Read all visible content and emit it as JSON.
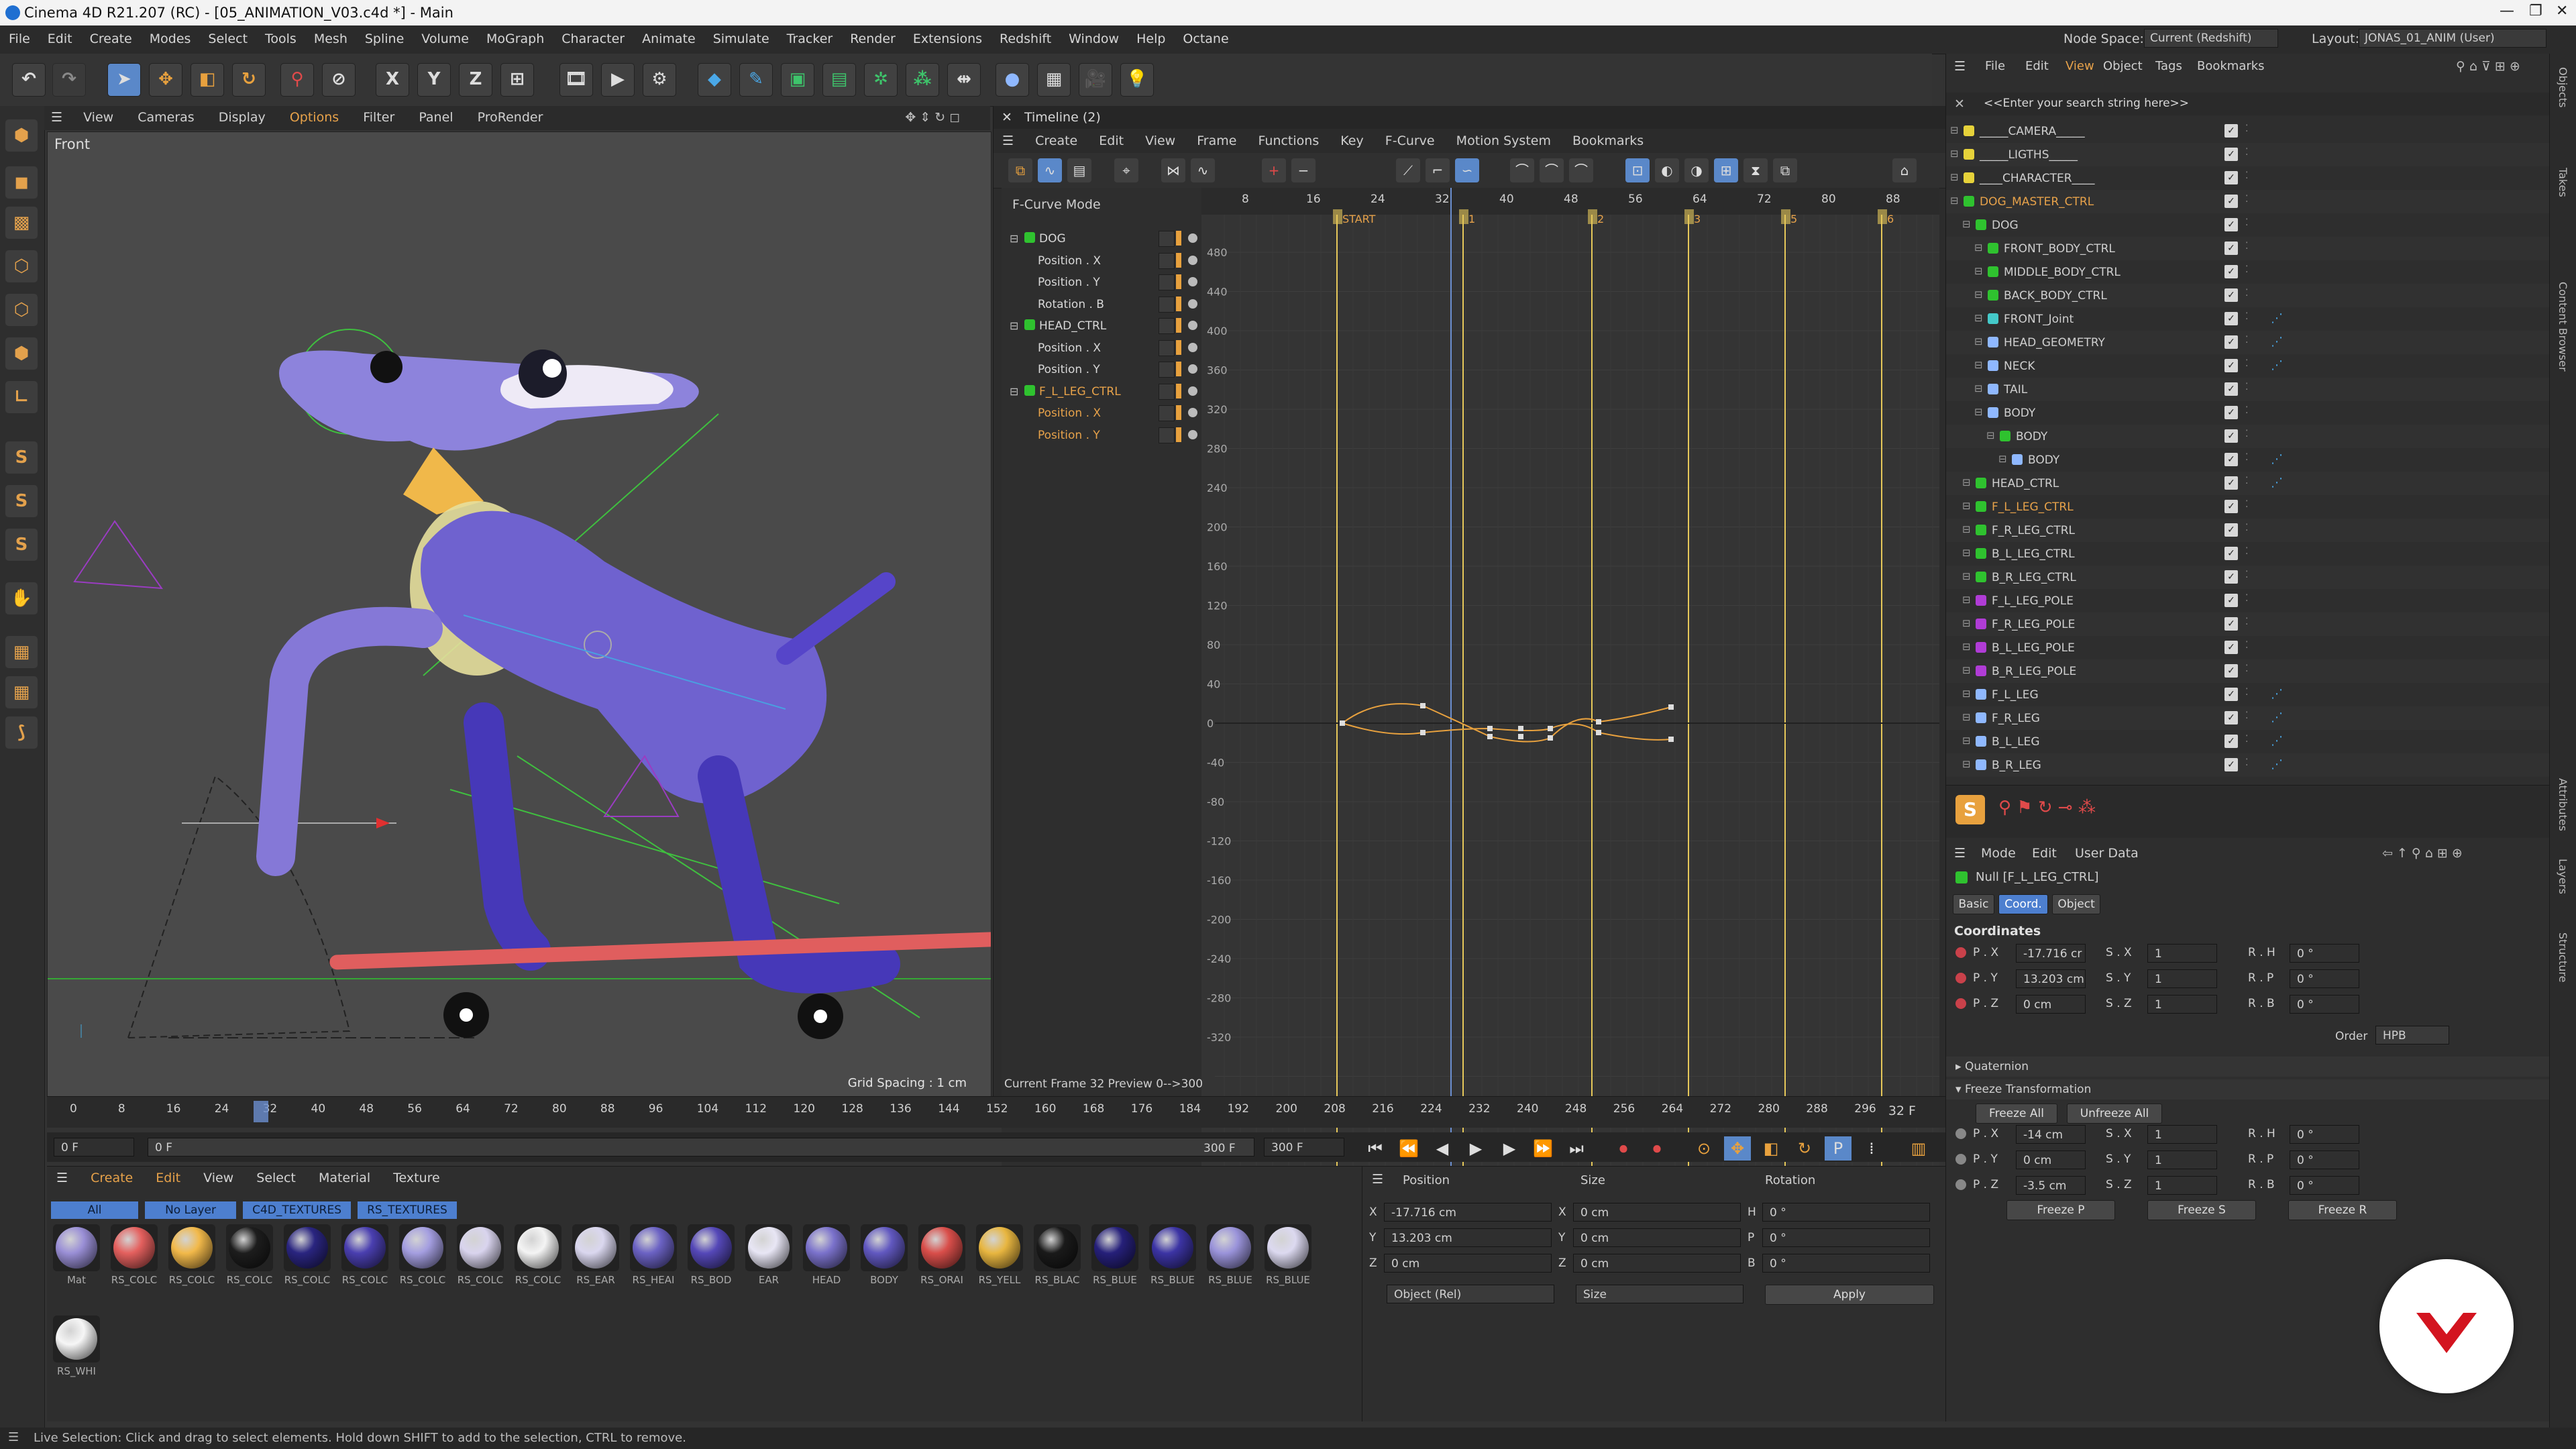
{
  "window": {
    "title": "Cinema 4D R21.207 (RC) - [05_ANIMATION_V03.c4d *] - Main",
    "node_space_label": "Node Space:",
    "node_space_value": "Current (Redshift)",
    "layout_label": "Layout:",
    "layout_value": "JONAS_01_ANIM (User)"
  },
  "menu": [
    "File",
    "Edit",
    "Create",
    "Modes",
    "Select",
    "Tools",
    "Mesh",
    "Spline",
    "Volume",
    "MoGraph",
    "Character",
    "Animate",
    "Simulate",
    "Tracker",
    "Render",
    "Extensions",
    "Redshift",
    "Window",
    "Help",
    "Octane"
  ],
  "viewport": {
    "menu": [
      "View",
      "Cameras",
      "Display",
      "Options",
      "Filter",
      "Panel",
      "ProRender"
    ],
    "name": "Front",
    "grid_spacing": "Grid Spacing : 1 cm"
  },
  "timeline": {
    "title": "Timeline (2)",
    "menu": [
      "Create",
      "Edit",
      "View",
      "Frame",
      "Functions",
      "Key",
      "F-Curve",
      "Motion System",
      "Bookmarks"
    ],
    "mode": "F-Curve Mode",
    "tracks": [
      {
        "name": "DOG",
        "type": "object"
      },
      {
        "name": "Position . X",
        "type": "param"
      },
      {
        "name": "Position . Y",
        "type": "param"
      },
      {
        "name": "Rotation . B",
        "type": "param"
      },
      {
        "name": "HEAD_CTRL",
        "type": "object"
      },
      {
        "name": "Position . X",
        "type": "param"
      },
      {
        "name": "Position . Y",
        "type": "param"
      },
      {
        "name": "F_L_LEG_CTRL",
        "type": "object-sel"
      },
      {
        "name": "Position . X",
        "type": "param-sel"
      },
      {
        "name": "Position . Y",
        "type": "param-sel"
      }
    ],
    "frame_ticks": [
      "8",
      "16",
      "24",
      "32",
      "40",
      "48",
      "56",
      "64",
      "72",
      "80",
      "88"
    ],
    "markers": [
      "START",
      "1",
      "2",
      "3",
      "5",
      "6"
    ],
    "value_ticks": [
      "480",
      "440",
      "400",
      "360",
      "320",
      "280",
      "240",
      "200",
      "160",
      "120",
      "80",
      "40",
      "0",
      "-40",
      "-80",
      "-120",
      "-160",
      "-200",
      "-240",
      "-280",
      "-320"
    ],
    "footer": "Current Frame  32  Preview  0-->300"
  },
  "ruler": {
    "ticks": [
      "0",
      "8",
      "16",
      "24",
      "32",
      "40",
      "48",
      "56",
      "64",
      "72",
      "80",
      "88",
      "96",
      "104",
      "112",
      "120",
      "128",
      "136",
      "144",
      "152",
      "160",
      "168",
      "176",
      "184",
      "192",
      "200",
      "208",
      "216",
      "224",
      "232",
      "240",
      "248",
      "256",
      "264",
      "272",
      "280",
      "288",
      "296"
    ],
    "current": "32 F"
  },
  "range": {
    "start": "0 F",
    "min": "0 F",
    "max": "300 F",
    "end": "300 F"
  },
  "materials": {
    "menu": [
      "Create",
      "Edit",
      "View",
      "Select",
      "Material",
      "Texture"
    ],
    "tabs": [
      "All",
      "No Layer",
      "C4D_TEXTURES",
      "RS_TEXTURES"
    ],
    "items": [
      {
        "name": "Mat",
        "color": "#9a8fd6"
      },
      {
        "name": "RS_COLC",
        "color": "#e4605e"
      },
      {
        "name": "RS_COLC",
        "color": "#f2b94a"
      },
      {
        "name": "RS_COLC",
        "color": "#1d1d1d"
      },
      {
        "name": "RS_COLC",
        "color": "#2a2580"
      },
      {
        "name": "RS_COLC",
        "color": "#4a3fb0"
      },
      {
        "name": "RS_COLC",
        "color": "#a49ee0"
      },
      {
        "name": "RS_COLC",
        "color": "#d9d4ee"
      },
      {
        "name": "RS_COLC",
        "color": "#f4f4f4"
      },
      {
        "name": "RS_EAR",
        "color": "#dad7ef"
      },
      {
        "name": "RS_HEAI",
        "color": "#6b62c4"
      },
      {
        "name": "RS_BOD",
        "color": "#5548b8"
      },
      {
        "name": "EAR",
        "color": "#e8e6f5"
      },
      {
        "name": "HEAD",
        "color": "#7b72cc"
      },
      {
        "name": "BODY",
        "color": "#6158c0"
      },
      {
        "name": "RS_ORAI",
        "color": "#d94e4a"
      },
      {
        "name": "RS_YELL",
        "color": "#e8b640"
      },
      {
        "name": "RS_BLAC",
        "color": "#1a1a1a"
      },
      {
        "name": "RS_BLUE",
        "color": "#26207a"
      },
      {
        "name": "RS_BLUE",
        "color": "#3c34a4"
      },
      {
        "name": "RS_BLUE",
        "color": "#9a93da"
      },
      {
        "name": "RS_BLUE",
        "color": "#dcd9f0"
      },
      {
        "name": "RS_WHI",
        "color": "#f6f6f6"
      }
    ]
  },
  "coords": {
    "headers": [
      "Position",
      "Size",
      "Rotation"
    ],
    "rows": [
      {
        "axis": "X",
        "pos": "-17.716 cm",
        "saxis": "X",
        "size": "0 cm",
        "raxis": "H",
        "rot": "0 °"
      },
      {
        "axis": "Y",
        "pos": "13.203 cm",
        "saxis": "Y",
        "size": "0 cm",
        "raxis": "P",
        "rot": "0 °"
      },
      {
        "axis": "Z",
        "pos": "0 cm",
        "saxis": "Z",
        "size": "0 cm",
        "raxis": "B",
        "rot": "0 °"
      }
    ],
    "mode1": "Object (Rel)",
    "mode2": "Size",
    "apply": "Apply"
  },
  "objects": {
    "menu": [
      "File",
      "Edit",
      "View",
      "Object",
      "Tags",
      "Bookmarks"
    ],
    "search": "<<Enter your search string here>>",
    "rows": [
      {
        "name": "_____CAMERA_____",
        "indent": 0,
        "color": "#e6d23a",
        "tag": false
      },
      {
        "name": "_____LIGTHS_____",
        "indent": 0,
        "color": "#e6d23a",
        "tag": false
      },
      {
        "name": "____CHARACTER____",
        "indent": 0,
        "color": "#e6d23a",
        "tag": false
      },
      {
        "name": "DOG_MASTER_CTRL",
        "indent": 0,
        "color": "#2fc22f",
        "tag": false,
        "orange": true
      },
      {
        "name": "DOG",
        "indent": 1,
        "color": "#2fc22f",
        "tag": false
      },
      {
        "name": "FRONT_BODY_CTRL",
        "indent": 2,
        "color": "#2fc22f",
        "tag": false
      },
      {
        "name": "MIDDLE_BODY_CTRL",
        "indent": 2,
        "color": "#2fc22f",
        "tag": false
      },
      {
        "name": "BACK_BODY_CTRL",
        "indent": 2,
        "color": "#2fc22f",
        "tag": false
      },
      {
        "name": "FRONT_Joint",
        "indent": 2,
        "color": "#44c9c9",
        "tag": true
      },
      {
        "name": "HEAD_GEOMETRY",
        "indent": 2,
        "color": "#8fb8ff",
        "tag": true
      },
      {
        "name": "NECK",
        "indent": 2,
        "color": "#8fb8ff",
        "tag": true
      },
      {
        "name": "TAIL",
        "indent": 2,
        "color": "#8fb8ff",
        "tag": false
      },
      {
        "name": "BODY",
        "indent": 2,
        "color": "#8fb8ff",
        "tag": false
      },
      {
        "name": "BODY",
        "indent": 3,
        "color": "#2fc22f",
        "tag": false
      },
      {
        "name": "BODY",
        "indent": 4,
        "color": "#8fb8ff",
        "tag": true
      },
      {
        "name": "HEAD_CTRL",
        "indent": 1,
        "color": "#2fc22f",
        "tag": true
      },
      {
        "name": "F_L_LEG_CTRL",
        "indent": 1,
        "color": "#2fc22f",
        "tag": false,
        "orange": true
      },
      {
        "name": "F_R_LEG_CTRL",
        "indent": 1,
        "color": "#2fc22f",
        "tag": false
      },
      {
        "name": "B_L_LEG_CTRL",
        "indent": 1,
        "color": "#2fc22f",
        "tag": false
      },
      {
        "name": "B_R_LEG_CTRL",
        "indent": 1,
        "color": "#2fc22f",
        "tag": false
      },
      {
        "name": "F_L_LEG_POLE",
        "indent": 1,
        "color": "#b03cd6",
        "tag": false
      },
      {
        "name": "F_R_LEG_POLE",
        "indent": 1,
        "color": "#b03cd6",
        "tag": false
      },
      {
        "name": "B_L_LEG_POLE",
        "indent": 1,
        "color": "#b03cd6",
        "tag": false
      },
      {
        "name": "B_R_LEG_POLE",
        "indent": 1,
        "color": "#b03cd6",
        "tag": false
      },
      {
        "name": "F_L_LEG",
        "indent": 1,
        "color": "#8fb8ff",
        "tag": true
      },
      {
        "name": "F_R_LEG",
        "indent": 1,
        "color": "#8fb8ff",
        "tag": true
      },
      {
        "name": "B_L_LEG",
        "indent": 1,
        "color": "#8fb8ff",
        "tag": true
      },
      {
        "name": "B_R_LEG",
        "indent": 1,
        "color": "#8fb8ff",
        "tag": true
      }
    ]
  },
  "attributes": {
    "menu": [
      "Mode",
      "Edit",
      "User Data"
    ],
    "object": "Null [F_L_LEG_CTRL]",
    "tabs": [
      "Basic",
      "Coord.",
      "Object"
    ],
    "section": "Coordinates",
    "rows": [
      {
        "p": "P . X",
        "pv": "-17.716 cr",
        "s": "S . X",
        "sv": "1",
        "r": "R . H",
        "rv": "0 °"
      },
      {
        "p": "P . Y",
        "pv": "13.203 cm",
        "s": "S . Y",
        "sv": "1",
        "r": "R . P",
        "rv": "0 °"
      },
      {
        "p": "P . Z",
        "pv": "0 cm",
        "s": "S . Z",
        "sv": "1",
        "r": "R . B",
        "rv": "0 °"
      }
    ],
    "order_label": "Order",
    "order_value": "HPB",
    "quaternion": "Quaternion",
    "freeze": "Freeze Transformation",
    "freeze_all": "Freeze All",
    "unfreeze_all": "Unfreeze All",
    "frows": [
      {
        "p": "P . X",
        "pv": "-14 cm",
        "s": "S . X",
        "sv": "1",
        "r": "R . H",
        "rv": "0 °"
      },
      {
        "p": "P . Y",
        "pv": "0 cm",
        "s": "S . Y",
        "sv": "1",
        "r": "R . P",
        "rv": "0 °"
      },
      {
        "p": "P . Z",
        "pv": "-3.5 cm",
        "s": "S . Z",
        "sv": "1",
        "r": "R . B",
        "rv": "0 °"
      }
    ],
    "freeze_p": "Freeze P",
    "freeze_s": "Freeze S",
    "freeze_r": "Freeze R"
  },
  "right_strip": [
    "Objects",
    "Takes",
    "Content Browser",
    "Attributes",
    "Layers",
    "Structure"
  ],
  "status": "Live Selection: Click and drag to select elements. Hold down SHIFT to add to the selection, CTRL to remove."
}
